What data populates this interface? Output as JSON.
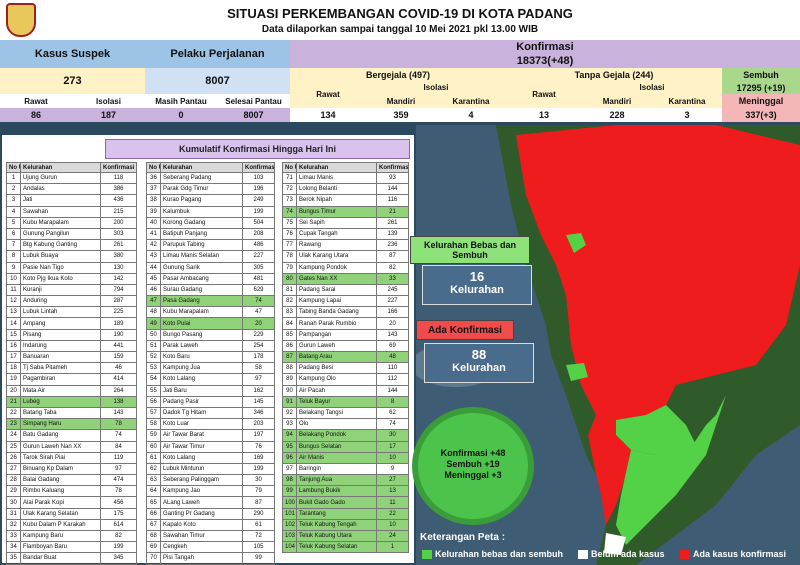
{
  "header": {
    "title": "SITUASI PERKEMBANGAN COVID-19 DI KOTA PADANG",
    "subtitle": "Data dilaporkan sampai tanggal 10 Mei 2021 pkl 13.00 WIB"
  },
  "stats": {
    "suspek_label": "Kasus Suspek",
    "suspek_value": "273",
    "rawat_label": "Rawat",
    "rawat_value": "86",
    "isolasi_label": "Isolasi",
    "isolasi_value": "187",
    "perjalanan_label": "Pelaku Perjalanan",
    "perjalanan_value": "8007",
    "masih_label": "Masih Pantau",
    "masih_value": "0",
    "selesai_label": "Selesai Pantau",
    "selesai_value": "8007",
    "konfirmasi_label": "Konfirmasi",
    "konfirmasi_value": "18373(+48)",
    "bergejala_label": "Bergejala (497)",
    "tanpa_label": "Tanpa Gejala (244)",
    "b_rawat_label": "Rawat",
    "b_rawat_value": "134",
    "b_isolasi_label": "Isolasi",
    "b_mandiri_label": "Mandiri",
    "b_mandiri_value": "359",
    "b_karantina_label": "Karantina",
    "b_karantina_value": "4",
    "t_rawat_label": "Rawat",
    "t_rawat_value": "13",
    "t_isolasi_label": "Isolasi",
    "t_mandiri_label": "Mandiri",
    "t_mandiri_value": "228",
    "t_karantina_label": "Karantina",
    "t_karantina_value": "3",
    "sembuh_label": "Sembuh",
    "sembuh_value": "17295 (+19)",
    "meninggal_label": "Meninggal",
    "meninggal_value": "337(+3)"
  },
  "table": {
    "title": "Kumulatif Konfirmasi Hingga Hari Ini",
    "headers": [
      "No Urut",
      "Kelurahan",
      "Konfirmasi"
    ],
    "col1": [
      [
        "1",
        "Ujung Gurun",
        "118"
      ],
      [
        "2",
        "Andalas",
        "386"
      ],
      [
        "3",
        "Jati",
        "436"
      ],
      [
        "4",
        "Sawahan",
        "215"
      ],
      [
        "5",
        "Kubu Marapalam",
        "200"
      ],
      [
        "6",
        "Gunung Pangilun",
        "303"
      ],
      [
        "7",
        "Btg Kabung Ganting",
        "261"
      ],
      [
        "8",
        "Lubuk Buaya",
        "380"
      ],
      [
        "9",
        "Pasie Nan Tigo",
        "130"
      ],
      [
        "10",
        "Koto Pjg Ikua Koto",
        "142"
      ],
      [
        "11",
        "Kuranji",
        "794"
      ],
      [
        "12",
        "Anduring",
        "287"
      ],
      [
        "13",
        "Lubuk Lintah",
        "225"
      ],
      [
        "14",
        "Ampang",
        "189"
      ],
      [
        "15",
        "Pisang",
        "190"
      ],
      [
        "16",
        "Indarung",
        "441"
      ],
      [
        "17",
        "Banuaran",
        "159"
      ],
      [
        "18",
        "Tj Saba Pitameh",
        "46"
      ],
      [
        "19",
        "Pagambiran",
        "414"
      ],
      [
        "20",
        "Mata Air",
        "264"
      ],
      [
        "21",
        "Lubeg",
        "138"
      ],
      [
        "22",
        "Batang Taba",
        "143"
      ],
      [
        "23",
        "Simpang Haru",
        "78"
      ],
      [
        "24",
        "Batu Gadang",
        "74"
      ],
      [
        "25",
        "Gurun Laweh Nan XX",
        "84"
      ],
      [
        "26",
        "Tarok Sirah Piai",
        "119"
      ],
      [
        "27",
        "Binuang Kp Dalam",
        "97"
      ],
      [
        "28",
        "Balai Gadang",
        "474"
      ],
      [
        "29",
        "Rimbo Kaluang",
        "78"
      ],
      [
        "30",
        "Alai Parak Kopi",
        "456"
      ],
      [
        "31",
        "Ulak Karang Selatan",
        "175"
      ],
      [
        "32",
        "Kubu Dalam P Karakah",
        "614"
      ],
      [
        "33",
        "Kampung Baru",
        "82"
      ],
      [
        "34",
        "Flamboyan Baru",
        "199"
      ],
      [
        "35",
        "Bandar Buat",
        "345"
      ]
    ],
    "col2": [
      [
        "36",
        "Seberang Padang",
        "103"
      ],
      [
        "37",
        "Parak Gdg Timur",
        "196"
      ],
      [
        "38",
        "Kurao Pagang",
        "249"
      ],
      [
        "39",
        "Kalumbuk",
        "199"
      ],
      [
        "40",
        "Korong Gadang",
        "504"
      ],
      [
        "41",
        "Batipuh Panjang",
        "208"
      ],
      [
        "42",
        "Parupuk Tabing",
        "486"
      ],
      [
        "43",
        "Limau Manis Selatan",
        "227"
      ],
      [
        "44",
        "Gunung Sarik",
        "305"
      ],
      [
        "45",
        "Pasar Ambacang",
        "481"
      ],
      [
        "46",
        "Surau Gadang",
        "629"
      ],
      [
        "47",
        "Pasa Gadang",
        "74"
      ],
      [
        "48",
        "Kubu Marapalam",
        "47"
      ],
      [
        "49",
        "Koto Pulai",
        "20"
      ],
      [
        "50",
        "Bungo Pasang",
        "229"
      ],
      [
        "51",
        "Parak Laweh",
        "254"
      ],
      [
        "52",
        "Koto Baru",
        "178"
      ],
      [
        "53",
        "Kampung Jua",
        "58"
      ],
      [
        "54",
        "Koto Lalang",
        "97"
      ],
      [
        "55",
        "Jati Baru",
        "162"
      ],
      [
        "56",
        "Padang Pasir",
        "145"
      ],
      [
        "57",
        "Dadok Tg Hitam",
        "346"
      ],
      [
        "58",
        "Koto Luar",
        "203"
      ],
      [
        "59",
        "Air Tawar Barat",
        "197"
      ],
      [
        "60",
        "Air Tawar Timur",
        "76"
      ],
      [
        "61",
        "Koto Lalang",
        "169"
      ],
      [
        "62",
        "Lubuk Minturun",
        "199"
      ],
      [
        "63",
        "Seberang Palinggam",
        "30"
      ],
      [
        "64",
        "Kampung Jao",
        "79"
      ],
      [
        "65",
        "ALang Laweh",
        "87"
      ],
      [
        "66",
        "Ganting Pr Gadang",
        "290"
      ],
      [
        "67",
        "Kapalo Koto",
        "61"
      ],
      [
        "68",
        "Sawahan Timur",
        "72"
      ],
      [
        "69",
        "Cengkeh",
        "105"
      ],
      [
        "70",
        "Pisi Tangah",
        "99"
      ]
    ],
    "col3": [
      [
        "71",
        "Limau Manis",
        "93"
      ],
      [
        "72",
        "Lolong Belanti",
        "144"
      ],
      [
        "73",
        "Berok Nipah",
        "116"
      ],
      [
        "74",
        "Bungus Timur",
        "21"
      ],
      [
        "75",
        "Sei Sapih",
        "261"
      ],
      [
        "76",
        "Cupak Tangah",
        "139"
      ],
      [
        "77",
        "Rawang",
        "236"
      ],
      [
        "78",
        "Ulak Karang Utara",
        "87"
      ],
      [
        "79",
        "Kampung Pondok",
        "82"
      ],
      [
        "80",
        "Gates Nan XX",
        "33"
      ],
      [
        "81",
        "Padang Sarai",
        "245"
      ],
      [
        "82",
        "Kampung Lapai",
        "227"
      ],
      [
        "83",
        "Tabing Banda Gadang",
        "166"
      ],
      [
        "84",
        "Ranah Parak Rumbio",
        "20"
      ],
      [
        "85",
        "Pampangan",
        "143"
      ],
      [
        "86",
        "Gurun Laweh",
        "69"
      ],
      [
        "87",
        "Batang Arau",
        "48"
      ],
      [
        "88",
        "Padang Besi",
        "110"
      ],
      [
        "89",
        "Kampung Olo",
        "112"
      ],
      [
        "90",
        "Air Pacah",
        "144"
      ],
      [
        "91",
        "Teluk Bayur",
        "8"
      ],
      [
        "92",
        "Belakang Tangsi",
        "62"
      ],
      [
        "93",
        "Olo",
        "74"
      ],
      [
        "94",
        "Belakang Pondok",
        "30"
      ],
      [
        "95",
        "Bungus Selatan",
        "17"
      ],
      [
        "96",
        "Air Manis",
        "10"
      ],
      [
        "97",
        "Baringin",
        "9"
      ],
      [
        "98",
        "Tanjung Aua",
        "27"
      ],
      [
        "99",
        "Lambung Bukik",
        "13"
      ],
      [
        "100",
        "Bukit Gado Gado",
        "11"
      ],
      [
        "101",
        "Tarantang",
        "22"
      ],
      [
        "102",
        "Teluk Kabung Tengah",
        "10"
      ],
      [
        "103",
        "Teluk Kabung Utara",
        "24"
      ],
      [
        "104",
        "Teluk Kabung Selatan",
        "1"
      ]
    ],
    "highlight_col1": [
      21,
      23
    ],
    "highlight_col2": [
      47,
      49
    ],
    "highlight_col3": [
      74,
      80,
      87,
      91,
      94,
      95,
      96,
      98,
      99,
      100,
      101,
      102,
      103,
      104
    ]
  },
  "map": {
    "bebas_title": "Kelurahan Bebas dan Sembuh",
    "bebas_value": "16",
    "bebas_unit": "Kelurahan",
    "konfirmasi_title": "Ada Konfirmasi",
    "konfirmasi_value": "88",
    "konfirmasi_unit": "Kelurahan",
    "virus_line1": "Konfirmasi +48",
    "virus_line2": "Sembuh +19",
    "virus_line3": "Meninggal +3"
  },
  "legend": {
    "title": "Keterangan Peta :",
    "item1": "Kelurahan bebas dan sembuh",
    "item2": "Belum ada kasus",
    "item3": "Ada kasus konfirmasi",
    "color1": "#54d247",
    "color2": "#ffffff",
    "color3": "#ee1c1c"
  },
  "colors": {
    "red_zone": "#ee1c1c",
    "green_zone": "#54d247",
    "highlight": "#8fd27a"
  }
}
